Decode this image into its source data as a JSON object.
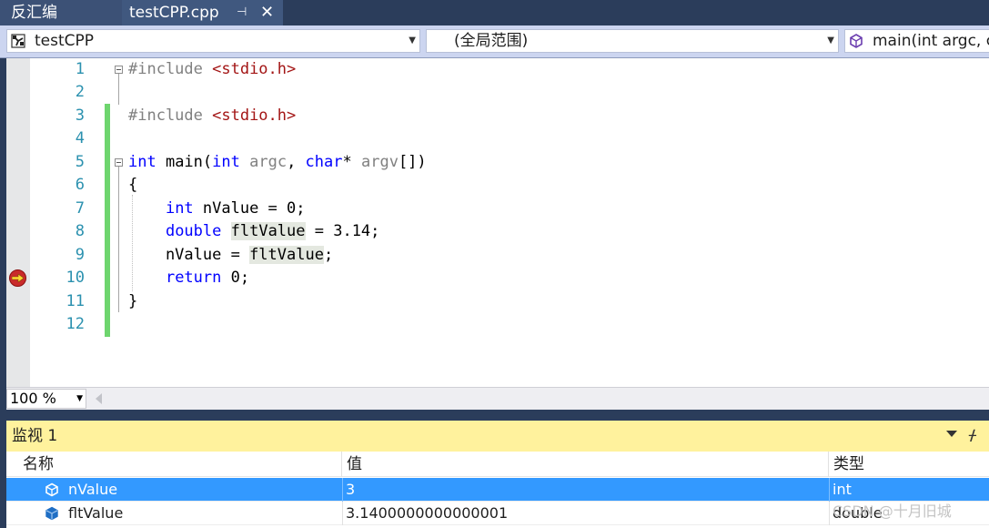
{
  "tabs": {
    "disassembly": "反汇编",
    "active_file": "testCPP.cpp",
    "pin_glyph": "⊣",
    "close_glyph": "✕"
  },
  "navbar": {
    "project": "testCPP",
    "scope": "(全局范围)",
    "member": "main(int argc, c"
  },
  "editor": {
    "line_numbers": [
      "1",
      "2",
      "3",
      "4",
      "5",
      "6",
      "7",
      "8",
      "9",
      "10",
      "11",
      "12"
    ],
    "current_line": 10
  },
  "zoom": {
    "level": "100 %"
  },
  "watch": {
    "title": "监视 1",
    "columns": {
      "name": "名称",
      "value": "值",
      "type": "类型"
    },
    "rows": [
      {
        "name": "nValue",
        "value": "3",
        "type": "int"
      },
      {
        "name": "fltValue",
        "value": "3.1400000000000001",
        "type": "double"
      }
    ]
  },
  "watermark": "CSDN @十月旧城",
  "colors": {
    "tab_bg": "#2b3d5b",
    "keyword": "#0000ff",
    "string": "#a31515",
    "line_number": "#2b91af",
    "watch_title_bg": "#fff29d",
    "selection": "#3399ff",
    "breakpoint": "#c92b2b"
  }
}
